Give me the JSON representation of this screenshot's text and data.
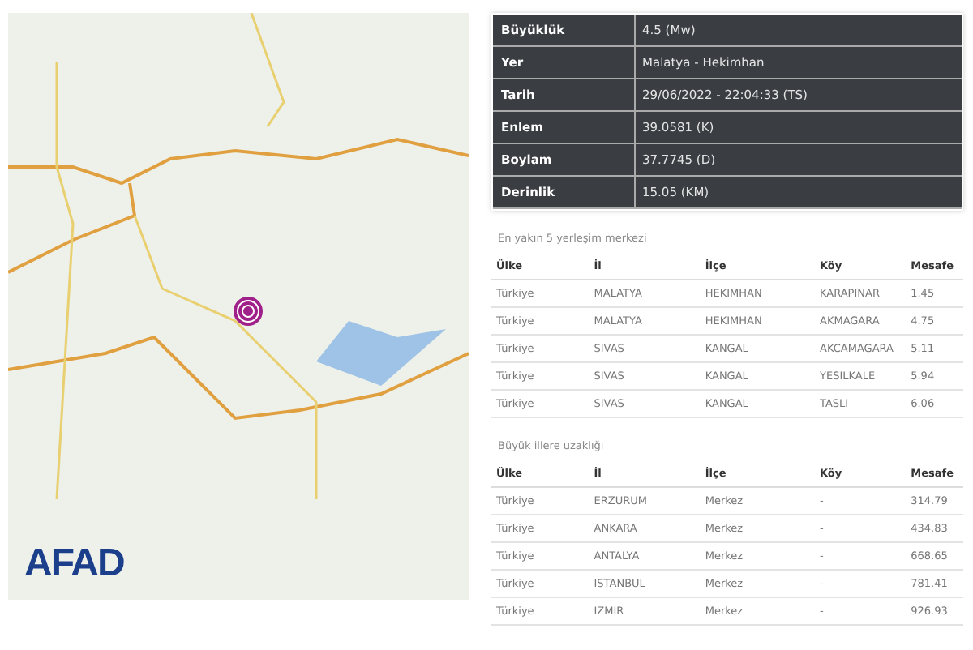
{
  "map": {
    "logo": "AFAD"
  },
  "summary": [
    {
      "label": "Büyüklük",
      "value": "4.5 (Mw)"
    },
    {
      "label": "Yer",
      "value": "Malatya - Hekimhan"
    },
    {
      "label": "Tarih",
      "value": "29/06/2022 - 22:04:33 (TS)"
    },
    {
      "label": "Enlem",
      "value": "39.0581 (K)"
    },
    {
      "label": "Boylam",
      "value": "37.7745 (D)"
    },
    {
      "label": "Derinlik",
      "value": "15.05 (KM)"
    }
  ],
  "tables": [
    {
      "caption": "En yakın 5 yerleşim merkezi",
      "columns": [
        "Ülke",
        "İl",
        "İlçe",
        "Köy",
        "Mesafe"
      ],
      "rows": [
        [
          "Türkiye",
          "MALATYA",
          "HEKIMHAN",
          "KARAPINAR",
          "1.45"
        ],
        [
          "Türkiye",
          "MALATYA",
          "HEKIMHAN",
          "AKMAGARA",
          "4.75"
        ],
        [
          "Türkiye",
          "SIVAS",
          "KANGAL",
          "AKCAMAGARA",
          "5.11"
        ],
        [
          "Türkiye",
          "SIVAS",
          "KANGAL",
          "YESILKALE",
          "5.94"
        ],
        [
          "Türkiye",
          "SIVAS",
          "KANGAL",
          "TASLI",
          "6.06"
        ]
      ]
    },
    {
      "caption": "Büyük illere uzaklığı",
      "columns": [
        "Ülke",
        "İl",
        "İlçe",
        "Köy",
        "Mesafe"
      ],
      "rows": [
        [
          "Türkiye",
          "ERZURUM",
          "Merkez",
          "-",
          "314.79"
        ],
        [
          "Türkiye",
          "ANKARA",
          "Merkez",
          "-",
          "434.83"
        ],
        [
          "Türkiye",
          "ANTALYA",
          "Merkez",
          "-",
          "668.65"
        ],
        [
          "Türkiye",
          "ISTANBUL",
          "Merkez",
          "-",
          "781.41"
        ],
        [
          "Türkiye",
          "IZMIR",
          "Merkez",
          "-",
          "926.93"
        ]
      ]
    }
  ]
}
